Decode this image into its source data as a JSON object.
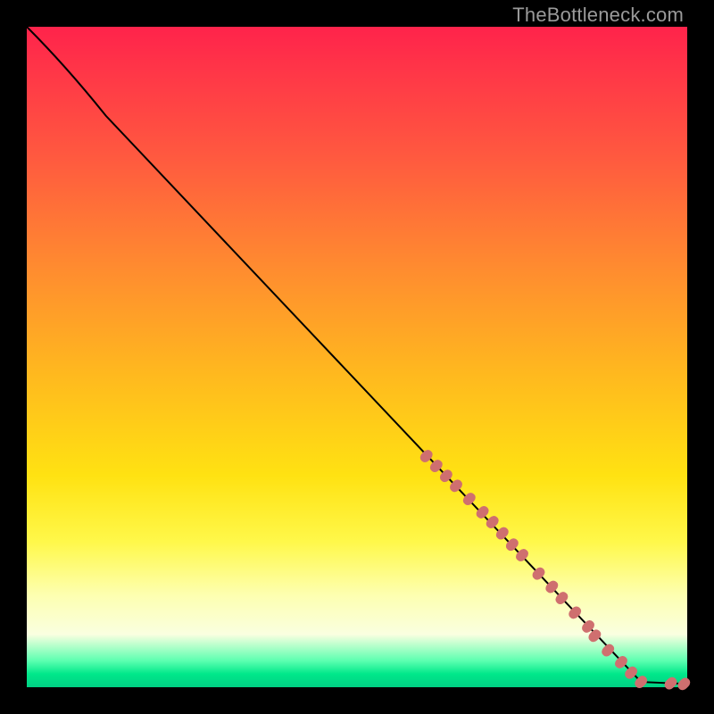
{
  "watermark": "TheBottleneck.com",
  "colors": {
    "background": "#000000",
    "point": "#cf6f6f",
    "curve": "#000000",
    "gradient_stops": [
      "#ff234b",
      "#ff5a3f",
      "#ffb71f",
      "#ffe212",
      "#fdffb0",
      "#00d084"
    ]
  },
  "chart_data": {
    "type": "line",
    "title": "",
    "xlabel": "",
    "ylabel": "",
    "xlim": [
      0,
      100
    ],
    "ylim": [
      0,
      100
    ],
    "grid": false,
    "legend": false,
    "curve": {
      "description": "monotone decreasing concave curve from top-left to bottom-right",
      "control_points_xy": [
        [
          0,
          100
        ],
        [
          6,
          94
        ],
        [
          12,
          86.5
        ],
        [
          93,
          0.8
        ],
        [
          100,
          0.5
        ]
      ]
    },
    "series": [
      {
        "name": "points",
        "xy": [
          [
            60.5,
            35.0
          ],
          [
            62.0,
            33.5
          ],
          [
            63.5,
            32.0
          ],
          [
            65.0,
            30.5
          ],
          [
            67.0,
            28.5
          ],
          [
            69.0,
            26.5
          ],
          [
            70.5,
            25.0
          ],
          [
            72.0,
            23.3
          ],
          [
            73.5,
            21.6
          ],
          [
            75.0,
            20.0
          ],
          [
            77.5,
            17.2
          ],
          [
            79.5,
            15.2
          ],
          [
            81.0,
            13.5
          ],
          [
            83.0,
            11.3
          ],
          [
            85.0,
            9.2
          ],
          [
            86.0,
            7.8
          ],
          [
            88.0,
            5.6
          ],
          [
            90.0,
            3.8
          ],
          [
            91.5,
            2.2
          ],
          [
            93.0,
            0.8
          ],
          [
            97.5,
            0.6
          ],
          [
            99.5,
            0.5
          ]
        ]
      }
    ]
  }
}
